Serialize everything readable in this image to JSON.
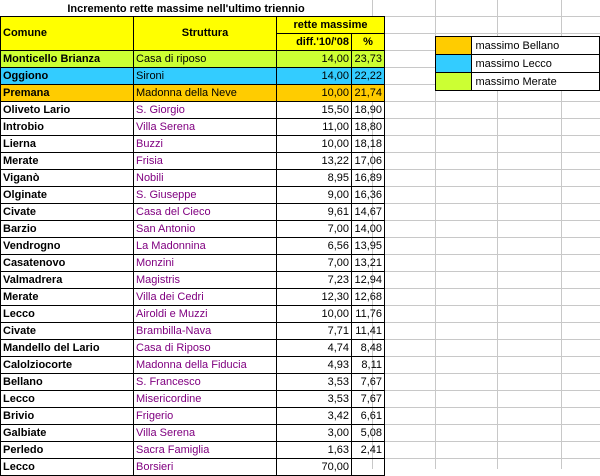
{
  "title": "Incremento rette massime nell'ultimo triennio",
  "headers": {
    "comune": "Comune",
    "struttura": "Struttura",
    "rette": "rette massime",
    "diff": "diff.'10/'08",
    "pct": "%"
  },
  "rows": [
    {
      "comune": "Monticello Brianza",
      "struttura": "Casa di riposo",
      "diff": "14,00",
      "pct": "23,73",
      "hl": "y"
    },
    {
      "comune": "Oggiono",
      "struttura": "Sironi",
      "diff": "14,00",
      "pct": "22,22",
      "hl": "b"
    },
    {
      "comune": "Premana",
      "struttura": "Madonna della Neve",
      "diff": "10,00",
      "pct": "21,74",
      "hl": "o"
    },
    {
      "comune": "Oliveto Lario",
      "struttura": "S. Giorgio",
      "diff": "15,50",
      "pct": "18,90"
    },
    {
      "comune": "Introbio",
      "struttura": "Villa Serena",
      "diff": "11,00",
      "pct": "18,80"
    },
    {
      "comune": "Lierna",
      "struttura": "Buzzi",
      "diff": "10,00",
      "pct": "18,18"
    },
    {
      "comune": "Merate",
      "struttura": "Frisia",
      "diff": "13,22",
      "pct": "17,06"
    },
    {
      "comune": "Viganò",
      "struttura": "Nobili",
      "diff": "8,95",
      "pct": "16,89"
    },
    {
      "comune": "Olginate",
      "struttura": "S. Giuseppe",
      "diff": "9,00",
      "pct": "16,36"
    },
    {
      "comune": "Civate",
      "struttura": "Casa del Cieco",
      "diff": "9,61",
      "pct": "14,67"
    },
    {
      "comune": "Barzio",
      "struttura": "San Antonio",
      "diff": "7,00",
      "pct": "14,00"
    },
    {
      "comune": "Vendrogno",
      "struttura": "La Madonnina",
      "diff": "6,56",
      "pct": "13,95"
    },
    {
      "comune": "Casatenovo",
      "struttura": "Monzini",
      "diff": "7,00",
      "pct": "13,21"
    },
    {
      "comune": "Valmadrera",
      "struttura": "Magistris",
      "diff": "7,23",
      "pct": "12,94"
    },
    {
      "comune": "Merate",
      "struttura": "Villa dei Cedri",
      "diff": "12,30",
      "pct": "12,68"
    },
    {
      "comune": "Lecco",
      "struttura": "Airoldi e Muzzi",
      "diff": "10,00",
      "pct": "11,76"
    },
    {
      "comune": "Civate",
      "struttura": "Brambilla-Nava",
      "diff": "7,71",
      "pct": "11,41"
    },
    {
      "comune": "Mandello del Lario",
      "struttura": "Casa di Riposo",
      "diff": "4,74",
      "pct": "8,48"
    },
    {
      "comune": "Calolziocorte",
      "struttura": "Madonna della Fiducia",
      "diff": "4,93",
      "pct": "8,11"
    },
    {
      "comune": "Bellano",
      "struttura": "S. Francesco",
      "diff": "3,53",
      "pct": "7,67"
    },
    {
      "comune": "Lecco",
      "struttura": "Misericordine",
      "diff": "3,53",
      "pct": "7,67"
    },
    {
      "comune": "Brivio",
      "struttura": "Frigerio",
      "diff": "3,42",
      "pct": "6,61"
    },
    {
      "comune": "Galbiate",
      "struttura": "Villa Serena",
      "diff": "3,00",
      "pct": "5,08"
    },
    {
      "comune": "Perledo",
      "struttura": "Sacra Famiglia",
      "diff": "1,63",
      "pct": "2,41"
    },
    {
      "comune": "Lecco",
      "struttura": "Borsieri",
      "diff": "70,00",
      "pct": ""
    }
  ],
  "legend": [
    {
      "label": "massimo Bellano",
      "color": "#ffcc00"
    },
    {
      "label": "massimo Lecco",
      "color": "#33ccff"
    },
    {
      "label": "massimo Merate",
      "color": "#ccff33"
    }
  ],
  "colors": {
    "header": "#ffff00",
    "highlight_y": "#ccff33",
    "highlight_b": "#33ccff",
    "highlight_o": "#ffcc00",
    "struttura_text": "#800080"
  }
}
